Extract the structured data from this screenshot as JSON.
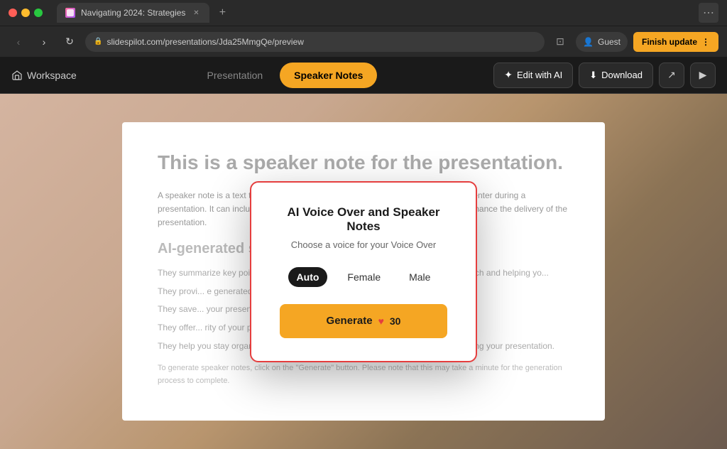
{
  "titlebar": {
    "tab_title": "Navigating 2024: Strategies",
    "tab_favicon_alt": "slidepilot-icon",
    "new_tab_label": "+",
    "window_menu_label": "⋯"
  },
  "navbar": {
    "back_label": "‹",
    "forward_label": "›",
    "refresh_label": "↻",
    "url": "slidespilot.com/presentations/Jda25MmgQe/preview",
    "share_label": "⊞",
    "guest_label": "Guest",
    "finish_update_label": "Finish update",
    "finish_update_menu_label": "⋮"
  },
  "toolbar": {
    "workspace_label": "Workspace",
    "tab_presentation": "Presentation",
    "tab_speaker_notes": "Speaker Notes",
    "edit_ai_label": "Edit with AI",
    "download_label": "Download",
    "share_icon": "↗",
    "play_icon": "▶"
  },
  "slide": {
    "title": "This is a speaker note for the presentation.",
    "body": "A speaker note is a text that provides additional information or guidance for the presenter during a presentation. It can include key points, reminders, explanations, or instructions to enhance the delivery of the presentation.",
    "section_title": "AI-generated speaker notes in several ways:",
    "list_items": [
      "They summarize key points or major takeaways from each slide, helping you... research and helping yo...",
      "They provi... e generated PowerPoint... ng a deeper understan...",
      "They save... your presentation...",
      "They offer... rity of your presentation...",
      "They help you stay organized and ensure that you cover all the important points during your presentation."
    ],
    "footer": "To generate speaker notes, click on the \"Generate\" button. Please note that this may take a minute for the generation process to complete."
  },
  "modal": {
    "title": "AI Voice Over and Speaker Notes",
    "subtitle": "Choose a voice for your Voice Over",
    "voice_options": [
      {
        "id": "auto",
        "label": "Auto",
        "selected": true
      },
      {
        "id": "female",
        "label": "Female",
        "selected": false
      },
      {
        "id": "male",
        "label": "Male",
        "selected": false
      }
    ],
    "generate_label": "Generate",
    "heart_icon": "♥",
    "credit_count": "30"
  },
  "colors": {
    "accent": "#f5a623",
    "modal_border": "#e53e3e",
    "dark_bg": "#1a1a1a",
    "selected_voice_bg": "#1a1a1a"
  }
}
